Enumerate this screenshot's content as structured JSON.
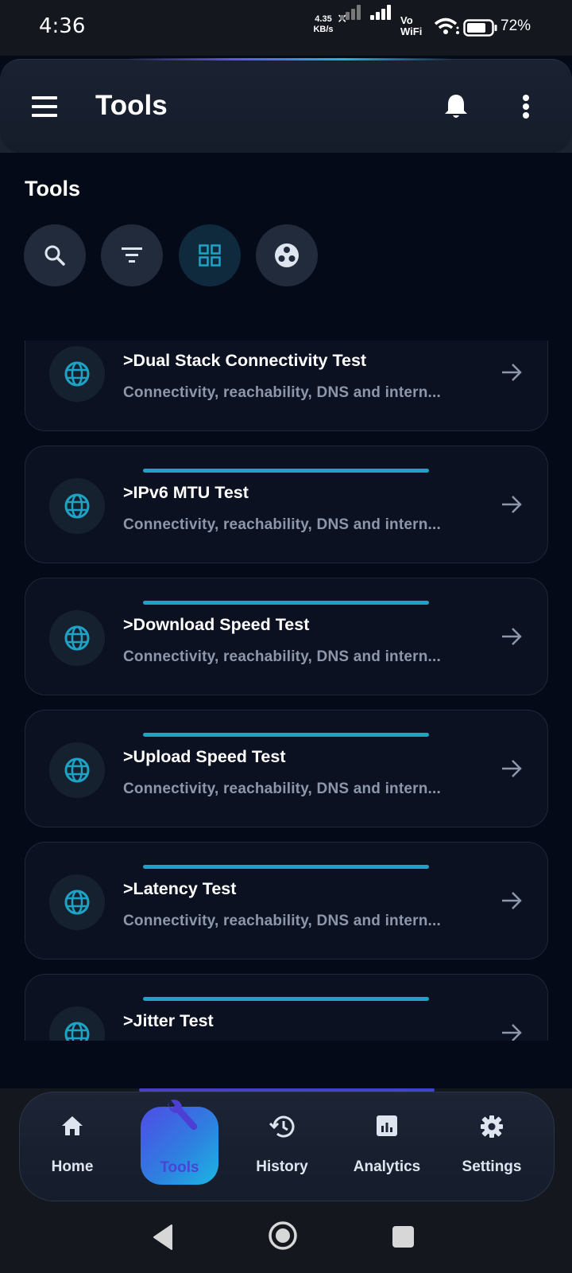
{
  "status_bar": {
    "time": "4:36",
    "net_speed_value": "4.35",
    "net_speed_unit": "KB/s",
    "volte_line1": "Vo",
    "volte_line2": "WiFi",
    "battery": "72%"
  },
  "app_bar": {
    "title": "Tools",
    "menu_icon": "hamburger-menu-icon",
    "notification_icon": "bell-icon",
    "overflow_icon": "more-vert-icon"
  },
  "section": {
    "title": "Tools",
    "actions": [
      {
        "icon": "search-icon"
      },
      {
        "icon": "filter-icon"
      },
      {
        "icon": "grid-view-icon",
        "active": true
      },
      {
        "icon": "category-icon"
      }
    ]
  },
  "tools": [
    {
      "title": ">Dual Stack Connectivity Test",
      "description": "Connectivity, reachability, DNS and intern...",
      "icon": "globe-icon"
    },
    {
      "title": ">IPv6 MTU Test",
      "description": "Connectivity, reachability, DNS and intern...",
      "icon": "globe-icon"
    },
    {
      "title": ">Download Speed Test",
      "description": "Connectivity, reachability, DNS and intern...",
      "icon": "globe-icon"
    },
    {
      "title": ">Upload Speed Test",
      "description": "Connectivity, reachability, DNS and intern...",
      "icon": "globe-icon"
    },
    {
      "title": ">Latency Test",
      "description": "Connectivity, reachability, DNS and intern...",
      "icon": "globe-icon"
    },
    {
      "title": ">Jitter Test",
      "description": "",
      "icon": "globe-icon"
    }
  ],
  "bottom_nav": {
    "items": [
      {
        "label": "Home",
        "icon": "home-icon"
      },
      {
        "label": "Tools",
        "icon": "wrench-icon",
        "active": true
      },
      {
        "label": "History",
        "icon": "history-icon"
      },
      {
        "label": "Analytics",
        "icon": "analytics-icon"
      },
      {
        "label": "Settings",
        "icon": "settings-icon"
      }
    ]
  },
  "colors": {
    "background": "#050a19",
    "card": "#0b1120",
    "accent_cyan": "#1ea3c6",
    "accent_indigo": "#4e4ce6",
    "muted_text": "#8d97ab"
  }
}
